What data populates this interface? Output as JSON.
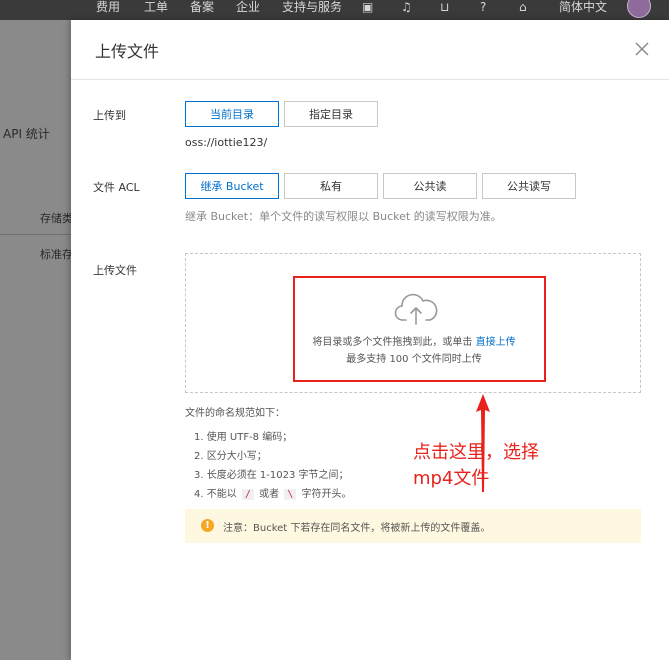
{
  "topbar": {
    "nav": [
      "费用",
      "工单",
      "备案",
      "企业",
      "支持与服务"
    ],
    "language": "简体中文"
  },
  "background": {
    "api_stats": "API 统计",
    "storage_col": "存储类",
    "standard_row": "标准存"
  },
  "dialog": {
    "title": "上传文件",
    "upload_to": {
      "label": "上传到",
      "options": [
        "当前目录",
        "指定目录"
      ],
      "selected": "当前目录",
      "path": "oss://iottie123/"
    },
    "acl": {
      "label": "文件 ACL",
      "options": [
        "继承 Bucket",
        "私有",
        "公共读",
        "公共读写"
      ],
      "selected": "继承 Bucket",
      "hint": "继承 Bucket：单个文件的读写权限以 Bucket 的读写权限为准。"
    },
    "upload_files": {
      "label": "上传文件",
      "drop_text": "将目录或多个文件拖拽到此，或单击",
      "direct_upload_link": "直接上传",
      "limit_text": "最多支持 100 个文件同时上传"
    },
    "naming_rules": {
      "title": "文件的命名规范如下：",
      "rule1": "1. 使用 UTF-8 编码；",
      "rule2": "2. 区分大小写；",
      "rule3": "3. 长度必须在 1-1023 字节之间；",
      "rule4_prefix": "4. 不能以",
      "rule4_slash": "/",
      "rule4_or": "或者",
      "rule4_backslash": "\\",
      "rule4_suffix": "字符开头。"
    },
    "notice": "注意：Bucket 下若存在同名文件，将被新上传的文件覆盖。"
  },
  "annotation": {
    "line1": "点击这里，选择",
    "line2": "mp4文件"
  },
  "colors": {
    "accent": "#0070cc",
    "annotation": "#e8221b",
    "notice_bg": "#fff8e1",
    "warning": "#f5a623"
  }
}
